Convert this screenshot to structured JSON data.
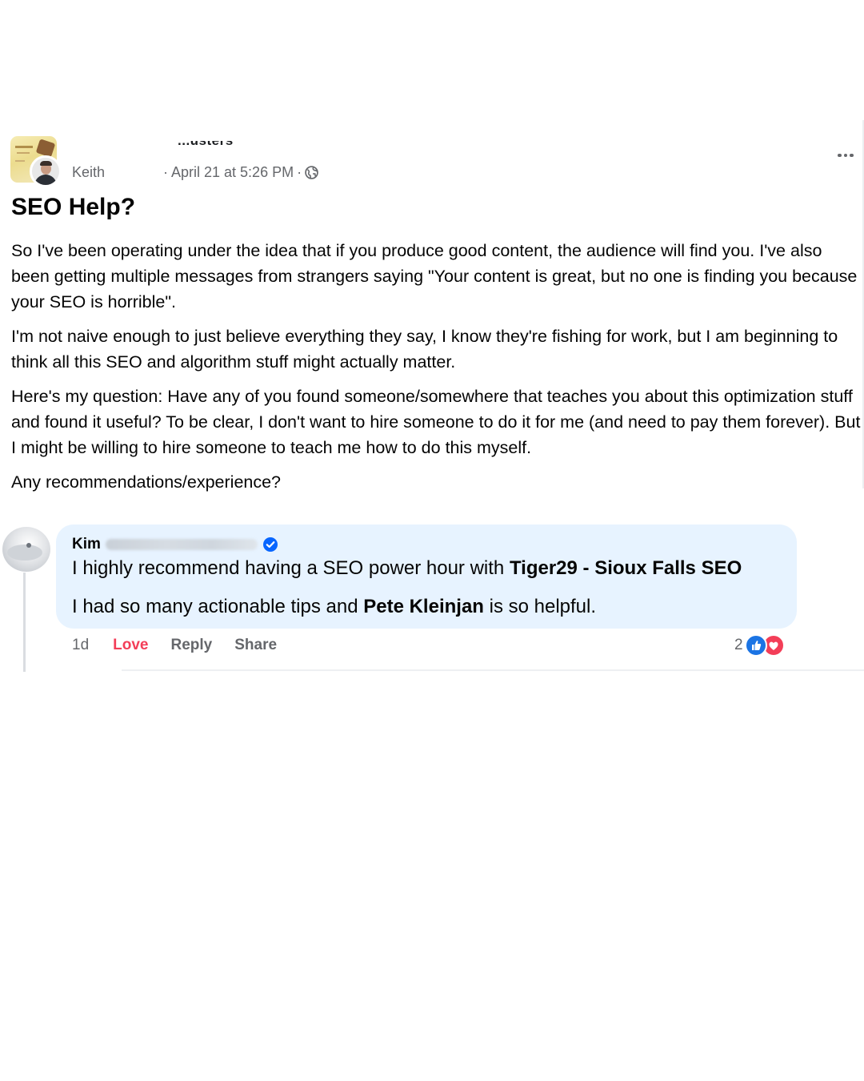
{
  "post": {
    "group_name_partial": "...usters",
    "author": "Keith",
    "timestamp": "April 21 at 5:26 PM",
    "separator": "·",
    "title": "SEO Help?",
    "paragraphs": [
      "So I've been operating under the idea that if you produce good content, the audience will find you. I've also been getting multiple messages from strangers saying \"Your content is great, but no one is finding you because your SEO is horrible\".",
      "I'm not naive enough to just believe everything they say, I know they're fishing for work, but I am beginning to think all this SEO and algorithm stuff might actually matter.",
      "Here's my question: Have any of you found someone/somewhere that teaches you about this optimization stuff and found it useful? To be clear, I don't want to hire someone to do it for me (and need to pay them forever). But I might be willing to hire someone to teach me how to do this myself.",
      "Any recommendations/experience?"
    ],
    "icons": {
      "privacy": "globe-icon",
      "more": "more-options-icon"
    }
  },
  "comment": {
    "commenter_first": "Kim",
    "line1_prefix": "I highly recommend having a SEO power hour with ",
    "line1_tag": "Tiger29 - Sioux Falls SEO",
    "line2_prefix": "I had so many actionable tips and ",
    "line2_tag": "Pete Kleinjan",
    "line2_suffix": " is so helpful.",
    "actions": {
      "time": "1d",
      "love": "Love",
      "reply": "Reply",
      "share": "Share"
    },
    "reaction_count": "2",
    "reaction_icons": [
      "like-icon",
      "love-icon"
    ],
    "colors": {
      "bubble": "#e7f3ff",
      "love": "#f33e58",
      "like": "#1b74e4",
      "verified": "#0866ff"
    }
  }
}
